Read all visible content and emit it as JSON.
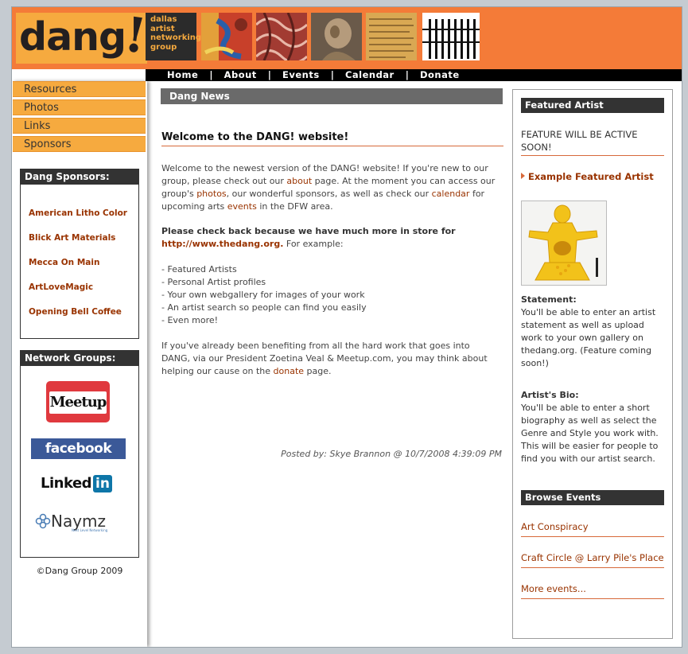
{
  "header": {
    "logo_text": "dang",
    "logo_bang": "!",
    "tagline": [
      "dallas",
      "artist",
      "networking",
      "group"
    ]
  },
  "nav": {
    "items": [
      "Home",
      "About",
      "Events",
      "Calendar",
      "Donate"
    ],
    "separator": "|"
  },
  "sidebar": {
    "nav_items": [
      "Resources",
      "Photos",
      "Links",
      "Sponsors"
    ],
    "sponsors_title": "Dang Sponsors:",
    "sponsors": [
      "American Litho Color",
      "Blick Art Materials",
      "Mecca On Main",
      "ArtLoveMagic",
      "Opening Bell Coffee"
    ],
    "network_title": "Network Groups:",
    "network_logos": {
      "meetup": "Meetup",
      "facebook": "facebook",
      "linkedin_a": "Linked",
      "linkedin_b": "in",
      "naymz": "Naymz",
      "naymz_tag": "Next Level Networking"
    },
    "copyright": "©Dang Group 2009"
  },
  "main": {
    "section_title": "Dang News",
    "post_title": "Welcome to the DANG! website!",
    "p1": {
      "t1": "Welcome to the newest version of the DANG! website! If you're new to our group, please check out our ",
      "l1": "about",
      "t2": " page. At the moment you can access our group's ",
      "l2": "photos",
      "t3": ", our wonderful sponsors, as well as check our ",
      "l3": "calendar",
      "t4": " for upcoming arts ",
      "l4": "events",
      "t5": " in the DFW area."
    },
    "p2": {
      "bold": "Please check back because we have much more in store for ",
      "link": "http://www.thedang.org.",
      "rest": " For example:"
    },
    "list": [
      "- Featured Artists",
      "- Personal Artist profiles",
      "- Your own webgallery for images of your work",
      "- An artist search so people can find you easily",
      "- Even more!"
    ],
    "p3": {
      "t1": "If you've already been benefiting from all the hard work that goes into DANG, via our President Zoetina Veal & Meetup.com, you may think about helping our cause on the ",
      "link": "donate",
      "t2": " page."
    },
    "posted_by": "Posted by: Skye Brannon @ 10/7/2008 4:39:09 PM"
  },
  "right": {
    "featured_title": "Featured Artist",
    "feature_notice": "FEATURE WILL BE ACTIVE SOON!",
    "example_link": "Example Featured  Artist",
    "statement_label": "Statement:",
    "statement_text": "You'll be able to enter an artist statement as well as upload work to your own gallery on thedang.org. (Feature coming soon!)",
    "bio_label": "Artist's Bio:",
    "bio_text": "You'll be able to enter a short biography as well as select the Genre and Style you work with. This will be easier for people to find you with our artist search.",
    "browse_title": "Browse Events",
    "events": [
      "Art Conspiracy",
      "Craft Circle @ Larry Pile's Place",
      "More events..."
    ]
  },
  "colors": {
    "orange": "#f47b38",
    "gold": "#f6aa3f",
    "link": "#993300",
    "dark": "#333333"
  }
}
